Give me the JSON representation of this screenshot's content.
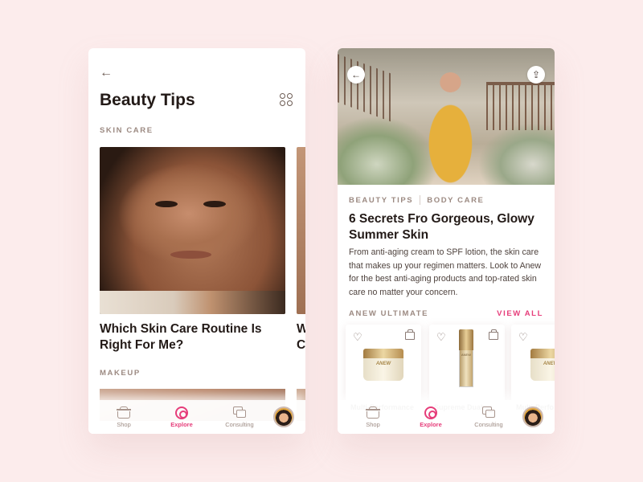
{
  "screen1": {
    "back_icon": "←",
    "title": "Beauty Tips",
    "section_skin": "SKIN CARE",
    "card_title": "Which Skin Care Routine Is Right For Me?",
    "peek_title_1": "W",
    "peek_title_2": "C",
    "section_makeup": "MAKEUP"
  },
  "screen2": {
    "back_icon": "←",
    "share_icon": "⇪",
    "tags": [
      "BEAUTY TIPS",
      "BODY CARE"
    ],
    "title": "6 Secrets Fro Gorgeous, Glowy Summer Skin",
    "body": "From anti-aging cream to SPF lotion, the skin care that makes up your regimen matters. Look to Anew for the best anti-aging products and top-rated skin care no matter your concern.",
    "collection": "ANEW ULTIMATE",
    "view_all": "VIEW ALL",
    "products": [
      {
        "name": "Multi-Performance",
        "brand": "ANEW"
      },
      {
        "name": "Supreme Dual",
        "brand": "ANEW"
      },
      {
        "name": "Multi-Perfo",
        "brand": "ANEW"
      }
    ],
    "heart_icon": "♡"
  },
  "tabbar": {
    "tabs": [
      {
        "label": "Shop",
        "icon": "basket-icon"
      },
      {
        "label": "Explore",
        "icon": "explore-icon",
        "active": true
      },
      {
        "label": "Consulting",
        "icon": "chat-icon"
      }
    ],
    "chat_dots": "···"
  },
  "colors": {
    "accent": "#e63d7a",
    "background": "#fcecec",
    "text": "#231a17",
    "muted": "#9c8a82"
  }
}
